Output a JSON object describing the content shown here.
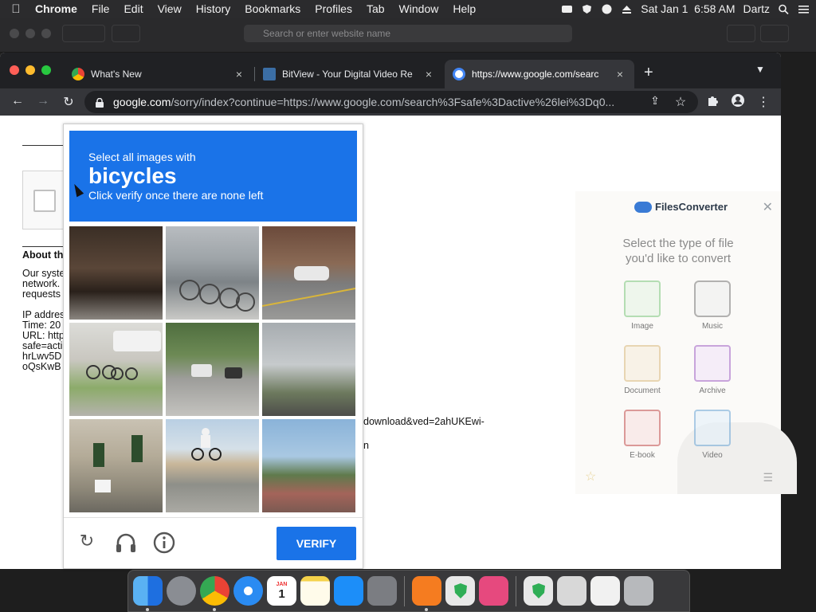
{
  "menubar": {
    "app": "Chrome",
    "items": [
      "File",
      "Edit",
      "View",
      "History",
      "Bookmarks",
      "Profiles",
      "Tab",
      "Window",
      "Help"
    ],
    "clock": "Sat Jan 1  6:58 AM",
    "user": "Dartz"
  },
  "bg_window": {
    "address_placeholder": "Search or enter website name"
  },
  "tabs": [
    {
      "title": "What's New",
      "close": "×"
    },
    {
      "title": "BitView - Your Digital Video Re",
      "close": "×"
    },
    {
      "title": "https://www.google.com/searc",
      "close": "×"
    }
  ],
  "toolbar": {
    "url_host": "google.com",
    "url_path": "/sorry/index?continue=https://www.google.com/search%3Fsafe%3Dactive%26lei%3Dq0..."
  },
  "page": {
    "heading": "About th",
    "lines": [
      "Our syste",
      "network.",
      "requests",
      "",
      "IP addres",
      "Time: 20",
      "URL: http",
      "safe=acti",
      "hrLwv5D",
      "oQsKwB"
    ],
    "url_tail_1": "download&ved=2ahUKEwi-",
    "url_tail_2": "n"
  },
  "recaptcha": {
    "instruction": "Select all images with",
    "target": "bicycles",
    "sub_instruction": "Click verify once there are none left",
    "verify_label": "VERIFY",
    "tiles": [
      "tile-1",
      "tile-2",
      "tile-3",
      "tile-4",
      "tile-5",
      "tile-6",
      "tile-7",
      "tile-8",
      "tile-9"
    ]
  },
  "files_converter": {
    "brand": "FilesConverter",
    "prompt_line1": "Select the type of file",
    "prompt_line2": "you'd like to convert",
    "items": [
      "Image",
      "Music",
      "Document",
      "Archive",
      "E-book",
      "Video"
    ]
  },
  "dock": {
    "items": [
      "Finder",
      "Launchpad",
      "Chrome",
      "Safari",
      "Calendar",
      "Notes",
      "App Store",
      "System Preferences",
      "Avast",
      "Shield",
      "Slides",
      "Security",
      "Downloads",
      "Preview",
      "Trash"
    ],
    "calendar_day": "1",
    "calendar_month": "JAN"
  },
  "colors": {
    "recaptcha_blue": "#1a73e8",
    "chrome_dark": "#202124",
    "chrome_toolbar": "#35363a",
    "mac_close": "#ff5f57",
    "mac_min": "#febc2e",
    "mac_max": "#28c840"
  }
}
